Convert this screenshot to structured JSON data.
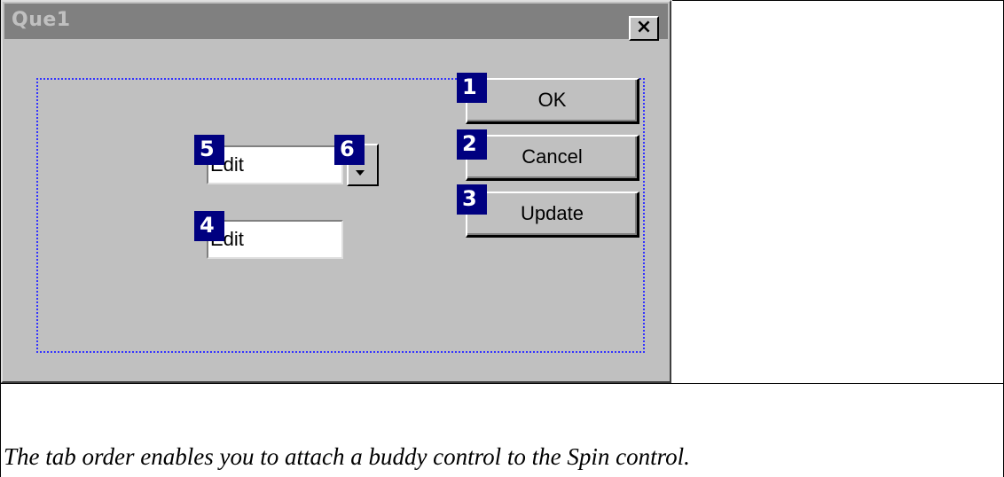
{
  "dialog": {
    "title": "Que1",
    "close_glyph": "×",
    "buttons": {
      "ok": "OK",
      "cancel": "Cancel",
      "update": "Update"
    },
    "edit1_text": "Edit",
    "edit2_text": "Edit",
    "spin_icon": "chevron-down-icon",
    "tab_badges": {
      "ok": "1",
      "cancel": "2",
      "update": "3",
      "edit2": "4",
      "edit1": "5",
      "spin": "6"
    }
  },
  "caption": "The tab order enables you to attach a buddy control to the Spin control.",
  "colors": {
    "dialog_bg": "#c0c0c0",
    "titlebar_bg": "#808080",
    "badge_bg": "#000080",
    "frame_dotted": "#3333ff"
  }
}
